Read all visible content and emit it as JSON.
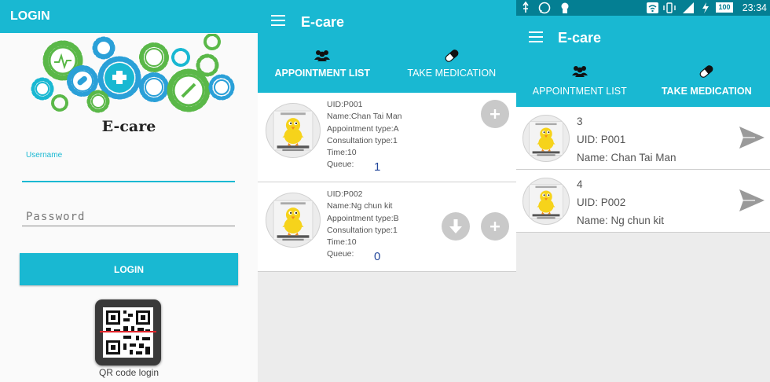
{
  "colors": {
    "accent": "#19b8d2",
    "status_bar": "#047f93",
    "queue_text": "#23479b"
  },
  "login_screen": {
    "header_title": "LOGIN",
    "brand_name": "E-care",
    "username_label": "Username",
    "password_placeholder": "Password",
    "login_button": "LOGIN",
    "qr_caption": "QR code login"
  },
  "appointment_screen": {
    "app_title": "E-care",
    "tabs": [
      {
        "label": "APPOINTMENT LIST",
        "icon": "group-icon",
        "active": true
      },
      {
        "label": "TAKE MEDICATION",
        "icon": "pill-icon",
        "active": false
      }
    ],
    "appointments": [
      {
        "uid": "UID:P001",
        "name": "Name:Chan Tai Man",
        "appointment_type": "Appointment type:A",
        "consultation_type": "Consultation type:1",
        "time": "Time:10",
        "queue_label": "Queue:",
        "queue_value": "1"
      },
      {
        "uid": "UID:P002",
        "name": "Name:Ng chun kit",
        "appointment_type": "Appointment type:B",
        "consultation_type": "Consultation type:1",
        "time": "Time:10",
        "queue_label": "Queue:",
        "queue_value": "0"
      }
    ]
  },
  "medication_screen": {
    "status_bar": {
      "battery": "100",
      "clock": "23:34"
    },
    "app_title": "E-care",
    "tabs": [
      {
        "label": "APPOINTMENT LIST",
        "icon": "group-icon",
        "active": false
      },
      {
        "label": "TAKE MEDICATION",
        "icon": "pill-icon",
        "active": true
      }
    ],
    "medications": [
      {
        "number": "3",
        "uid": "UID: P001",
        "name": "Name: Chan Tai Man"
      },
      {
        "number": "4",
        "uid": "UID: P002",
        "name": "Name: Ng chun kit"
      }
    ]
  }
}
